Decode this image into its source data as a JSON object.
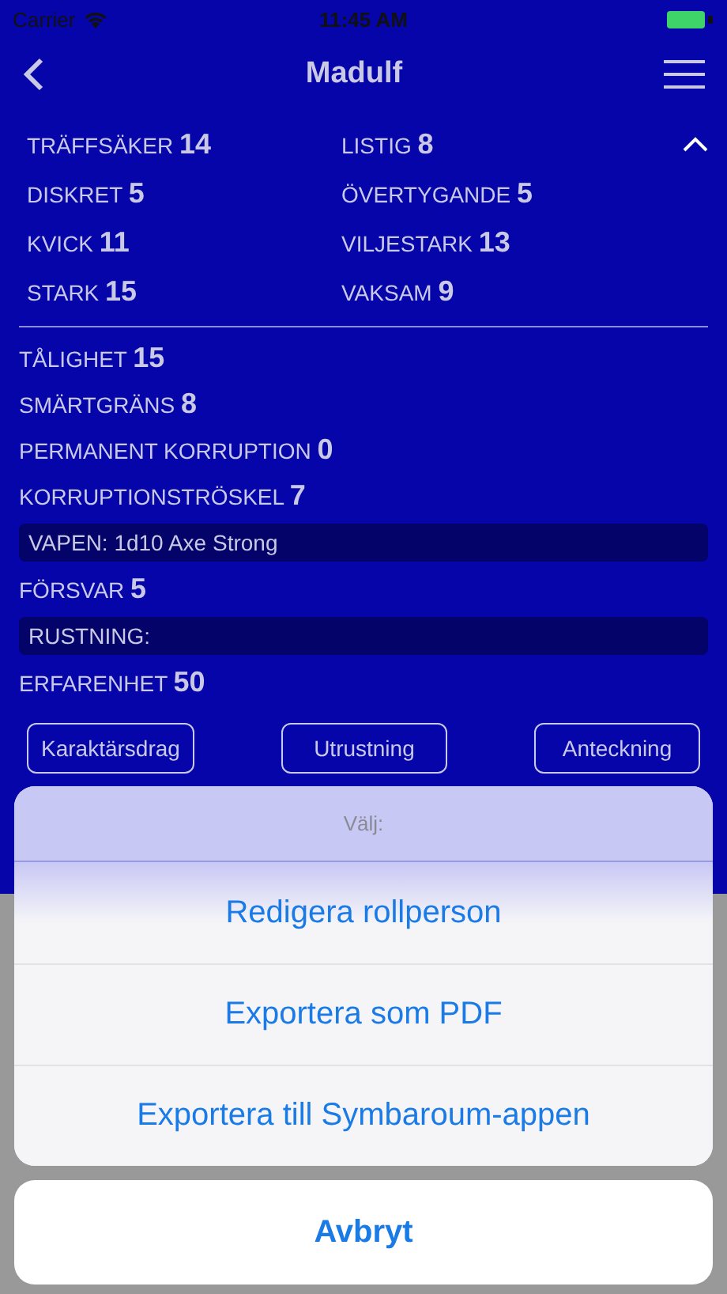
{
  "status_bar": {
    "carrier": "Carrier",
    "time": "11:45 AM"
  },
  "nav": {
    "title": "Madulf"
  },
  "attributes": [
    {
      "label": "TRÄFFSÄKER",
      "value": "14"
    },
    {
      "label": "LISTIG",
      "value": "8"
    },
    {
      "label": "DISKRET",
      "value": "5"
    },
    {
      "label": "ÖVERTYGANDE",
      "value": "5"
    },
    {
      "label": "KVICK",
      "value": "11"
    },
    {
      "label": "VILJESTARK",
      "value": "13"
    },
    {
      "label": "STARK",
      "value": "15"
    },
    {
      "label": "VAKSAM",
      "value": "9"
    }
  ],
  "attributes_expanded": true,
  "details": [
    {
      "kind": "stat",
      "label": "TÅLIGHET",
      "value": "15"
    },
    {
      "kind": "stat",
      "label": "SMÄRTGRÄNS",
      "value": "8"
    },
    {
      "kind": "stat",
      "label": "PERMANENT KORRUPTION",
      "value": "0"
    },
    {
      "kind": "stat",
      "label": "KORRUPTIONSTRÖSKEL",
      "value": "7"
    },
    {
      "kind": "bar",
      "label": "VAPEN: 1d10 Axe Strong"
    },
    {
      "kind": "stat",
      "label": "FÖRSVAR",
      "value": "5"
    },
    {
      "kind": "bar",
      "label": "RUSTNING:"
    },
    {
      "kind": "stat",
      "label": "ERFARENHET",
      "value": "50"
    }
  ],
  "tab_buttons": [
    "Karaktärsdrag",
    "Utrustning",
    "Anteckning"
  ],
  "action_sheet": {
    "title": "Välj:",
    "actions": [
      "Redigera rollperson",
      "Exportera som PDF",
      "Exportera till Symbaroum-appen"
    ],
    "cancel": "Avbryt"
  }
}
